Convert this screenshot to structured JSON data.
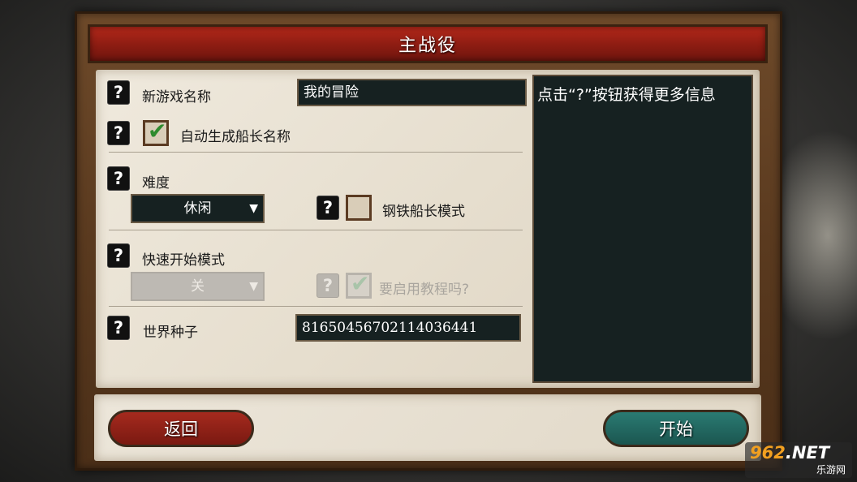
{
  "title": "主战役",
  "help_glyph": "?",
  "form": {
    "game_name_label": "新游戏名称",
    "game_name_value": "我的冒险",
    "auto_captain_label": "自动生成船长名称",
    "auto_captain_checked": true,
    "difficulty_label": "难度",
    "difficulty_value": "休闲",
    "iron_captain_label": "钢铁船长模式",
    "iron_captain_checked": false,
    "quick_start_label": "快速开始模式",
    "quick_start_value": "关",
    "tutorial_label": "要启用教程吗?",
    "tutorial_checked": true,
    "seed_label": "世界种子",
    "seed_value": "81650456702114036441"
  },
  "info_panel": {
    "text": "点击“?”按钮获得更多信息"
  },
  "buttons": {
    "back": "返回",
    "start": "开始"
  },
  "dropdown_arrow": "▼",
  "checkmark": "✔",
  "watermark": {
    "number": "962",
    "suffix": ".NET",
    "site": "乐游网"
  },
  "colors": {
    "title_bar": "#9c2216",
    "back_button": "#8f2117",
    "start_button": "#23675f",
    "panel_dark": "#162121",
    "parchment": "#e6dece"
  }
}
